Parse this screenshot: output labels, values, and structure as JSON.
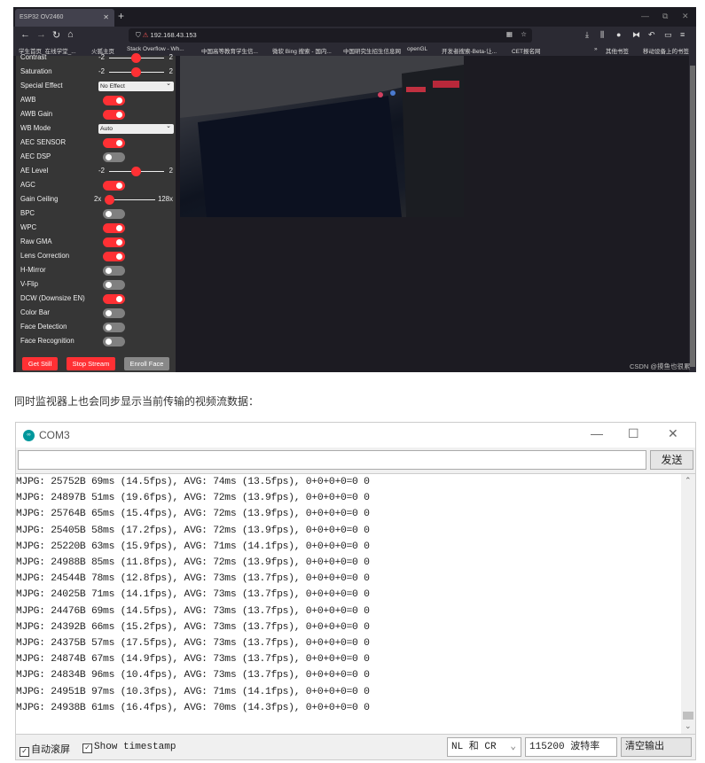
{
  "browser": {
    "tab_title": "ESP32 OV2460",
    "new_tab": "+",
    "url": "192.168.43.153",
    "bookmarks": [
      "学生首页_在线学堂_...",
      "火狐主页",
      "Stack Overflow - Wh...",
      "中国高等教育学生信...",
      "微软 Bing 搜索 - 国内...",
      "中国研究生招生信息网",
      "openGL",
      "开发者搜索-Beta-让...",
      "CET报名网"
    ],
    "bookmarks_right": [
      "其他书签",
      "移动设备上的书签"
    ]
  },
  "panel": {
    "sliders": [
      {
        "label": "Contrast",
        "min": "-2",
        "max": "2",
        "value": 0
      },
      {
        "label": "Saturation",
        "min": "-2",
        "max": "2",
        "value": 0
      }
    ],
    "special_effect": {
      "label": "Special Effect",
      "value": "No Effect"
    },
    "awb": {
      "label": "AWB",
      "on": true
    },
    "awb_gain": {
      "label": "AWB Gain",
      "on": true
    },
    "wb_mode": {
      "label": "WB Mode",
      "value": "Auto"
    },
    "aec_sensor": {
      "label": "AEC SENSOR",
      "on": true
    },
    "aec_dsp": {
      "label": "AEC DSP",
      "on": false
    },
    "ae_level": {
      "label": "AE Level",
      "min": "-2",
      "max": "2",
      "value": 0
    },
    "agc": {
      "label": "AGC",
      "on": true
    },
    "gain_ceiling": {
      "label": "Gain Ceiling",
      "min": "2x",
      "max": "128x",
      "value": "2x"
    },
    "toggles": [
      {
        "label": "BPC",
        "on": false
      },
      {
        "label": "WPC",
        "on": true
      },
      {
        "label": "Raw GMA",
        "on": true
      },
      {
        "label": "Lens Correction",
        "on": true
      },
      {
        "label": "H-Mirror",
        "on": false
      },
      {
        "label": "V-Flip",
        "on": false
      },
      {
        "label": "DCW (Downsize EN)",
        "on": true
      },
      {
        "label": "Color Bar",
        "on": false
      },
      {
        "label": "Face Detection",
        "on": false
      },
      {
        "label": "Face Recognition",
        "on": false
      }
    ],
    "buttons": {
      "get_still": "Get Still",
      "stop_stream": "Stop Stream",
      "enroll_face": "Enroll Face"
    }
  },
  "watermark": "CSDN @摸鱼也很累",
  "caption": "同时监视器上也会同步显示当前传输的视频流数据：",
  "serial": {
    "title": "COM3",
    "send": "发送",
    "input_value": "",
    "lines": [
      "MJPG: 25752B 69ms (14.5fps), AVG: 74ms (13.5fps), 0+0+0+0=0 0",
      "MJPG: 24897B 51ms (19.6fps), AVG: 72ms (13.9fps), 0+0+0+0=0 0",
      "MJPG: 25764B 65ms (15.4fps), AVG: 72ms (13.9fps), 0+0+0+0=0 0",
      "MJPG: 25405B 58ms (17.2fps), AVG: 72ms (13.9fps), 0+0+0+0=0 0",
      "MJPG: 25220B 63ms (15.9fps), AVG: 71ms (14.1fps), 0+0+0+0=0 0",
      "MJPG: 24988B 85ms (11.8fps), AVG: 72ms (13.9fps), 0+0+0+0=0 0",
      "MJPG: 24544B 78ms (12.8fps), AVG: 73ms (13.7fps), 0+0+0+0=0 0",
      "MJPG: 24025B 71ms (14.1fps), AVG: 73ms (13.7fps), 0+0+0+0=0 0",
      "MJPG: 24476B 69ms (14.5fps), AVG: 73ms (13.7fps), 0+0+0+0=0 0",
      "MJPG: 24392B 66ms (15.2fps), AVG: 73ms (13.7fps), 0+0+0+0=0 0",
      "MJPG: 24375B 57ms (17.5fps), AVG: 73ms (13.7fps), 0+0+0+0=0 0",
      "MJPG: 24874B 67ms (14.9fps), AVG: 73ms (13.7fps), 0+0+0+0=0 0",
      "MJPG: 24834B 96ms (10.4fps), AVG: 73ms (13.7fps), 0+0+0+0=0 0",
      "MJPG: 24951B 97ms (10.3fps), AVG: 71ms (14.1fps), 0+0+0+0=0 0",
      "MJPG: 24938B 61ms (16.4fps), AVG: 70ms (14.3fps), 0+0+0+0=0 0"
    ],
    "autoscroll": {
      "label": "自动滚屏",
      "checked": true
    },
    "timestamp": {
      "label": "Show timestamp",
      "checked": true
    },
    "line_ending": "NL 和 CR",
    "baud": "115200 波特率",
    "clear": "清空输出"
  }
}
